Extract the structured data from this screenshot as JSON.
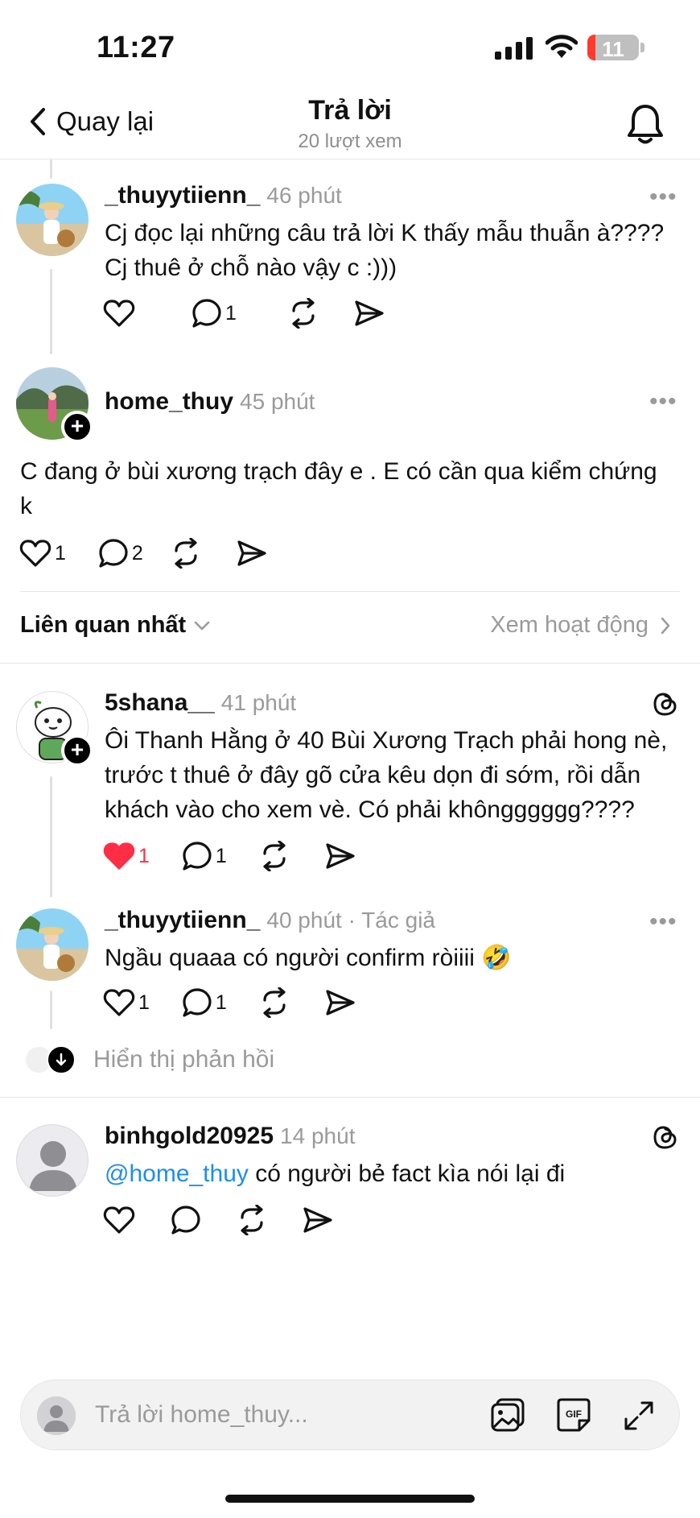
{
  "status_bar": {
    "time": "11:27",
    "battery": "11"
  },
  "nav": {
    "back_label": "Quay lại",
    "title": "Trả lời",
    "subtitle": "20 lượt xem"
  },
  "posts": [
    {
      "username": "_thuyytiienn_",
      "meta": "46 phút",
      "lines": [
        "Cj đọc lại những câu trả lời K thấy mẫu thuẫn à????",
        "Cj thuê ở chỗ nào vậy c :)))"
      ],
      "likes": "",
      "replies": "1"
    },
    {
      "username": "home_thuy",
      "meta": "45 phút",
      "lines": [
        "C đang ở bùi xương trạch đây e . E có cần qua kiểm chứng",
        "k"
      ],
      "likes": "1",
      "replies": "2"
    }
  ],
  "sort": {
    "label": "Liên quan nhất",
    "activity": "Xem hoạt động"
  },
  "replies": [
    {
      "username": "5shana__",
      "meta": "41 phút",
      "lines": [
        "Ôi Thanh Hằng ở 40 Bùi Xương Trạch phải hong nè,",
        "trước t thuê ở đây gõ cửa kêu dọn đi sớm, rồi dẫn",
        "khách vào cho xem vè. Có phải khôngggggg????"
      ],
      "likes": "1",
      "replies": "1",
      "liked": true
    },
    {
      "username": "_thuyytiienn_",
      "meta": "40 phút · Tác giả",
      "lines": [
        "Ngầu quaaa có người confirm ròiiii 🤣"
      ],
      "likes": "1",
      "replies": "1"
    },
    {
      "username": "binhgold20925",
      "meta": "14 phút",
      "mention": "@home_thuy",
      "text": " có người bẻ fact kìa nói lại đi",
      "likes": "",
      "replies": ""
    }
  ],
  "show_replies": "Hiển thị phản hồi",
  "composer": {
    "placeholder": "Trả lời home_thuy..."
  },
  "colors": {
    "like_red": "#ff2d46",
    "mention_blue": "#1d8cf0",
    "meta_gray": "#9a9a9a"
  }
}
